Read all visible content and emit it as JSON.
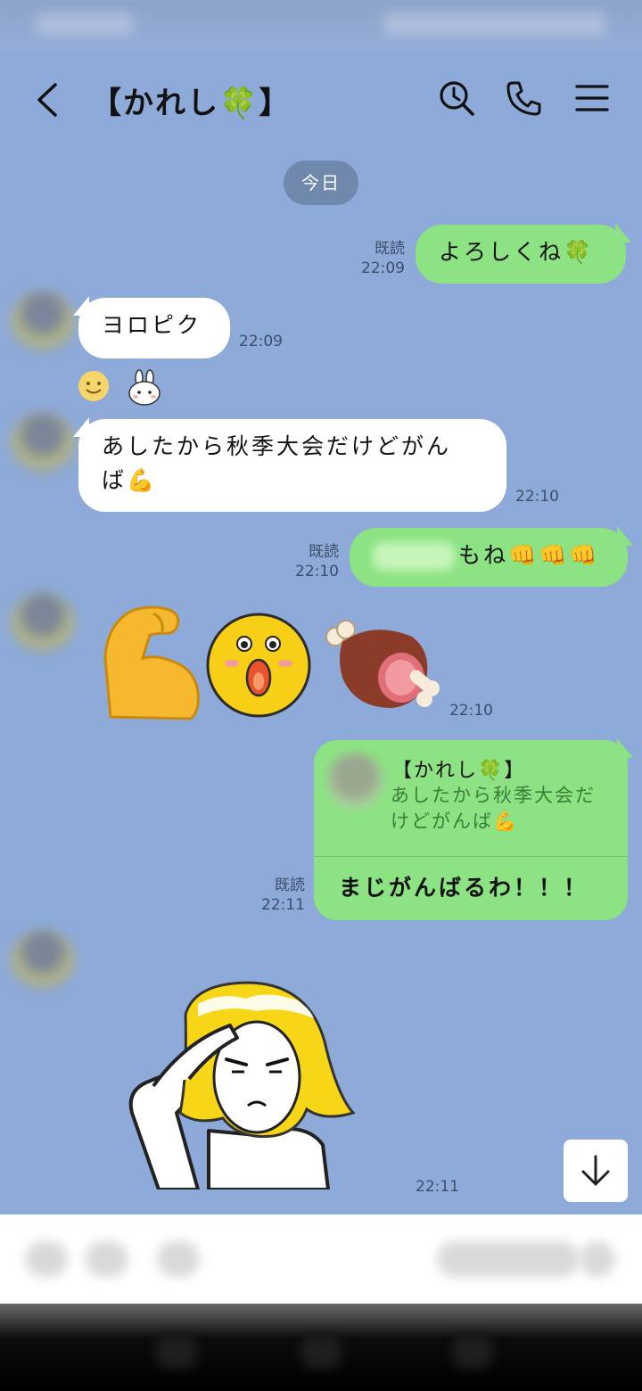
{
  "header": {
    "title": "【かれし🍀】",
    "back": "back",
    "search": "search",
    "call": "call",
    "menu": "menu"
  },
  "date_divider": "今日",
  "messages": [
    {
      "side": "me",
      "text": "よろしくね🍀",
      "read": "既読",
      "time": "22:09"
    },
    {
      "side": "them",
      "text": "ヨロピク",
      "time": "22:09"
    },
    {
      "side": "them",
      "text_line1": "あしたから秋季大会だけどがん",
      "text_line2": "ば💪",
      "time": "22:10"
    },
    {
      "side": "me",
      "text": "もね👊👊👊",
      "read": "既読",
      "time": "22:10"
    },
    {
      "side": "them",
      "type": "emoji",
      "emojis": [
        "💪",
        "😮",
        "🍖"
      ],
      "time": "22:10"
    },
    {
      "side": "me",
      "type": "reply",
      "quote_name": "【かれし🍀】",
      "quote_line1": "あしたから秋季大会だ",
      "quote_line2": "けどがんば💪",
      "text": "まじがんばるわ！！！",
      "read": "既読",
      "time": "22:11"
    },
    {
      "side": "them",
      "type": "sticker",
      "time": "22:11"
    }
  ],
  "icons": {
    "back": "chevron-left-icon",
    "search": "clock-search-icon",
    "call": "phone-icon",
    "menu": "hamburger-menu-icon",
    "scroll": "arrow-down-icon"
  },
  "colors": {
    "background": "#8eaad8",
    "my_bubble": "#8de383",
    "their_bubble": "#ffffff",
    "date_pill": "#7188ad"
  }
}
